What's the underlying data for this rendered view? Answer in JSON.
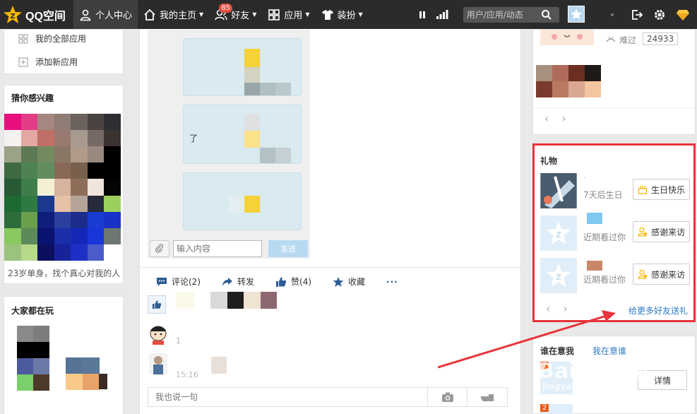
{
  "topbar": {
    "logo_text": "QQ空间",
    "nav": [
      {
        "label": "个人中心",
        "icon": "person-icon"
      },
      {
        "label": "我的主页",
        "icon": "home-icon"
      },
      {
        "label": "好友",
        "icon": "friends-icon",
        "badge": "85"
      },
      {
        "label": "应用",
        "icon": "apps-icon"
      },
      {
        "label": "装扮",
        "icon": "shirt-icon"
      }
    ],
    "search_placeholder": "用户/应用/动态"
  },
  "left": {
    "menu": [
      {
        "label": "我的全部应用",
        "icon": "grid-icon"
      },
      {
        "label": "添加新应用",
        "icon": "plus-square-icon"
      }
    ],
    "interest_title": "猜你感兴趣",
    "interest_caption": "23岁单身，找个真心对我的人",
    "playing_title": "大家都在玩"
  },
  "middle": {
    "chat_bubble_text": "了",
    "input_placeholder": "输入内容",
    "send_label": "发送",
    "actions": [
      {
        "label": "评论(2)",
        "icon": "comment-icon"
      },
      {
        "label": "转发",
        "icon": "forward-icon"
      },
      {
        "label": "赞(4)",
        "icon": "thumb-icon"
      },
      {
        "label": "收藏",
        "icon": "star-icon"
      },
      {
        "label": "···",
        "icon": "more-icon"
      }
    ],
    "comment_time": "15:16",
    "comment_placeholder": "我也说一句"
  },
  "right": {
    "top": {
      "passed_label": "难过",
      "count": "24933"
    },
    "gift": {
      "title": "礼物",
      "rows": [
        {
          "sub": "7天后生日",
          "button": "生日快乐"
        },
        {
          "sub": "近期看过你",
          "button": "感谢来访"
        },
        {
          "sub": "近期看过你",
          "button": "感谢来访"
        }
      ],
      "more_link": "给更多好友送礼"
    },
    "visitors": {
      "title": "谁在意我",
      "tab2": "我在意谁",
      "detail_button": "详情"
    }
  },
  "colors": {
    "topbar_bg": "#2b2b2b",
    "highlight_border": "#e8343a",
    "arrow": "#e8343a",
    "link": "#2e7bc4"
  }
}
